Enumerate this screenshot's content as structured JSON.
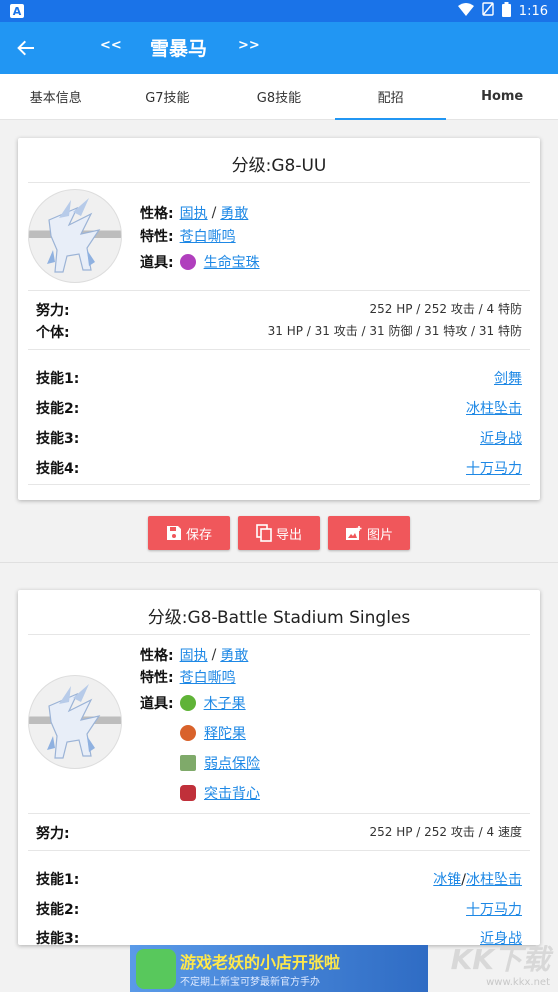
{
  "status": {
    "time": "1:16",
    "left_icon": "A"
  },
  "appbar": {
    "title": "雪暴马",
    "prev": "<<",
    "next": ">>"
  },
  "tabs": [
    {
      "label": "基本信息",
      "active": false
    },
    {
      "label": "G7技能",
      "active": false
    },
    {
      "label": "G8技能",
      "active": false
    },
    {
      "label": "配招",
      "active": true
    },
    {
      "label": "Home",
      "active": false
    }
  ],
  "sets": [
    {
      "title": "分级:G8-UU",
      "nature_label": "性格:",
      "nature1": "固执",
      "nature_sep": "/",
      "nature2": "勇敢",
      "ability_label": "特性:",
      "ability": "苍白嘶鸣",
      "item_label": "道具:",
      "items": [
        {
          "name": "生命宝珠",
          "color": "#b03fbd"
        }
      ],
      "ev_label": "努力:",
      "ev": "252 HP / 252 攻击 / 4 特防",
      "iv_label": "个体:",
      "iv": "31 HP / 31 攻击 / 31 防御 / 31 特攻 / 31 特防",
      "moves": [
        {
          "label": "技能1:",
          "value": "剑舞"
        },
        {
          "label": "技能2:",
          "value": "冰柱坠击"
        },
        {
          "label": "技能3:",
          "value": "近身战"
        },
        {
          "label": "技能4:",
          "value": "十万马力"
        }
      ]
    },
    {
      "title": "分级:G8-Battle Stadium Singles",
      "nature_label": "性格:",
      "nature1": "固执",
      "nature_sep": "/",
      "nature2": "勇敢",
      "ability_label": "特性:",
      "ability": "苍白嘶鸣",
      "item_label": "道具:",
      "items": [
        {
          "name": "木子果",
          "color": "#5fb337"
        },
        {
          "name": "释陀果",
          "color": "#d9622b"
        },
        {
          "name": "弱点保险",
          "color": "#7faa6a"
        },
        {
          "name": "突击背心",
          "color": "#c0303a"
        }
      ],
      "ev_label": "努力:",
      "ev": "252 HP / 252 攻击 / 4 速度",
      "moves": [
        {
          "label": "技能1:",
          "value1": "冰锥",
          "sep": "/",
          "value2": "冰柱坠击"
        },
        {
          "label": "技能2:",
          "value": "十万马力"
        },
        {
          "label": "技能3:",
          "value": "近身战"
        }
      ]
    }
  ],
  "actions": {
    "save": "保存",
    "export": "导出",
    "image": "图片"
  },
  "ad": {
    "title": "游戏老妖的小店开张啦",
    "subtitle": "不定期上新宝可梦最新官方手办"
  },
  "watermark": {
    "text": "KK下载",
    "url": "www.kkx.net"
  },
  "colors": {
    "primary": "#2196f3",
    "link": "#1e88e5",
    "action": "#f0575b"
  }
}
